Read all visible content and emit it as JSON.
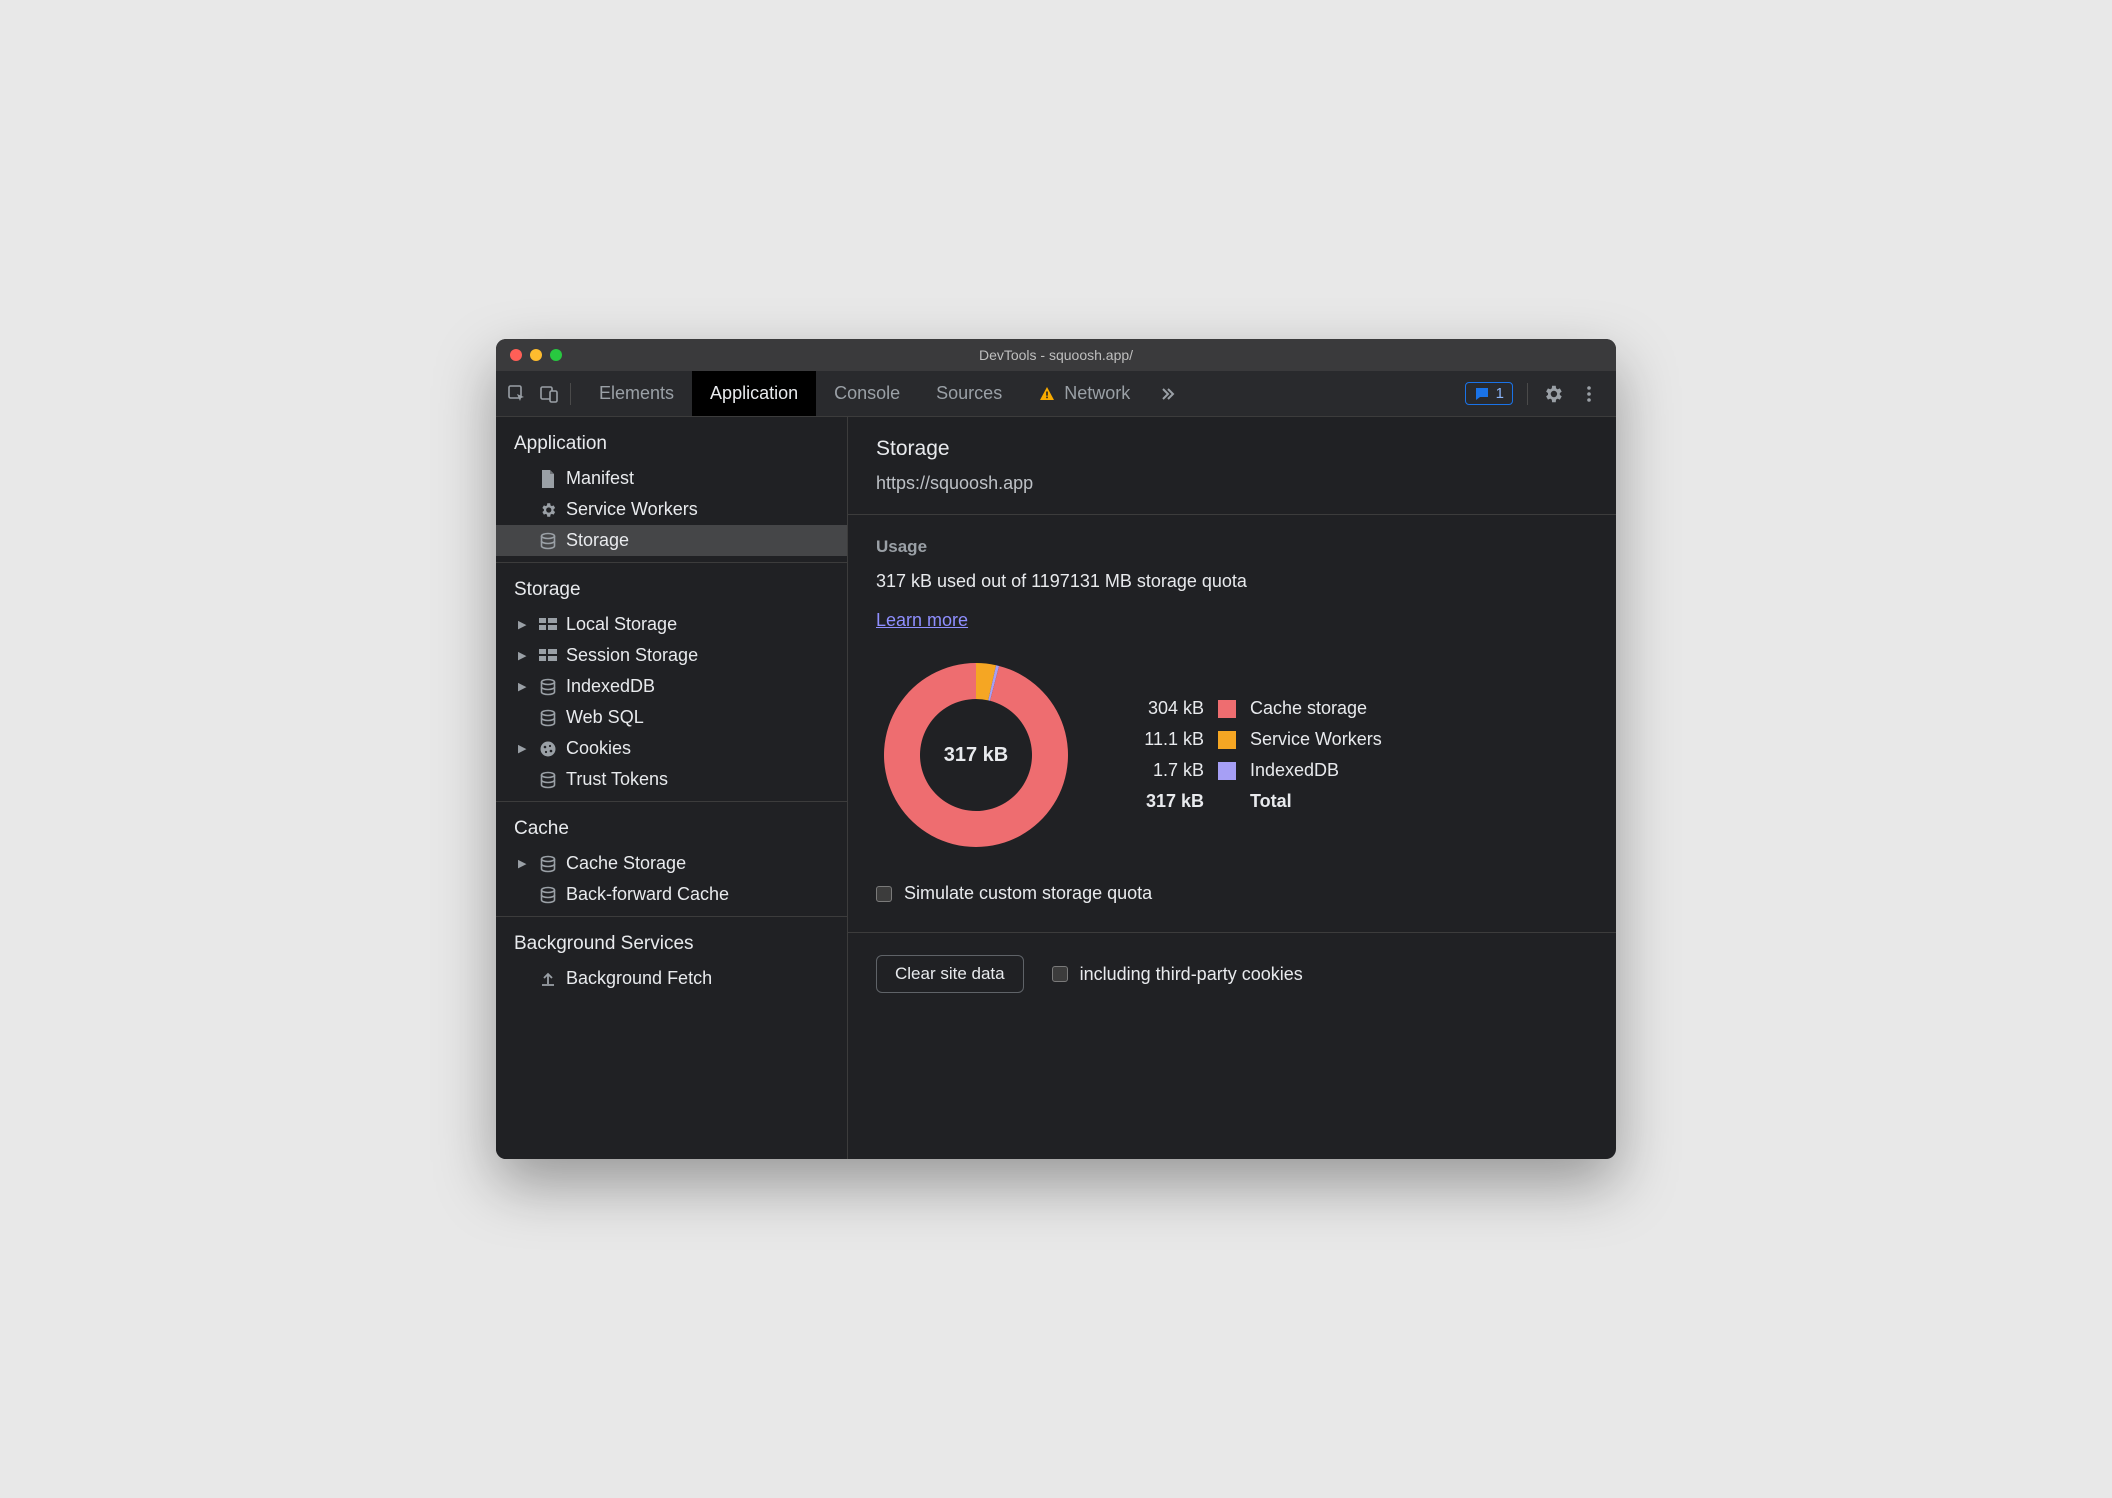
{
  "window": {
    "title": "DevTools - squoosh.app/"
  },
  "tabs": {
    "elements": "Elements",
    "application": "Application",
    "console": "Console",
    "sources": "Sources",
    "network": "Network"
  },
  "issues_count": "1",
  "sidebar": {
    "application": {
      "heading": "Application",
      "manifest": "Manifest",
      "service_workers": "Service Workers",
      "storage": "Storage"
    },
    "storage": {
      "heading": "Storage",
      "local_storage": "Local Storage",
      "session_storage": "Session Storage",
      "indexeddb": "IndexedDB",
      "web_sql": "Web SQL",
      "cookies": "Cookies",
      "trust_tokens": "Trust Tokens"
    },
    "cache": {
      "heading": "Cache",
      "cache_storage": "Cache Storage",
      "bf_cache": "Back-forward Cache"
    },
    "background": {
      "heading": "Background Services",
      "background_fetch": "Background Fetch"
    }
  },
  "main": {
    "title": "Storage",
    "origin": "https://squoosh.app",
    "usage_heading": "Usage",
    "usage_line": "317 kB used out of 1197131 MB storage quota",
    "learn_more": "Learn more",
    "donut_center": "317 kB",
    "legend": {
      "cache_storage": {
        "size": "304 kB",
        "label": "Cache storage",
        "color": "#ee6d70"
      },
      "service_workers": {
        "size": "11.1 kB",
        "label": "Service Workers",
        "color": "#f5a623"
      },
      "indexeddb": {
        "size": "1.7 kB",
        "label": "IndexedDB",
        "color": "#a69ff5"
      },
      "total": {
        "size": "317 kB",
        "label": "Total"
      }
    },
    "simulate_label": "Simulate custom storage quota",
    "clear_button": "Clear site data",
    "third_party_label": "including third-party cookies"
  },
  "chart_data": {
    "type": "pie",
    "title": "Storage usage breakdown",
    "series": [
      {
        "name": "Cache storage",
        "value": 304,
        "unit": "kB",
        "color": "#ee6d70"
      },
      {
        "name": "Service Workers",
        "value": 11.1,
        "unit": "kB",
        "color": "#f5a623"
      },
      {
        "name": "IndexedDB",
        "value": 1.7,
        "unit": "kB",
        "color": "#a69ff5"
      }
    ],
    "total": {
      "value": 317,
      "unit": "kB"
    },
    "center_label": "317 kB"
  }
}
